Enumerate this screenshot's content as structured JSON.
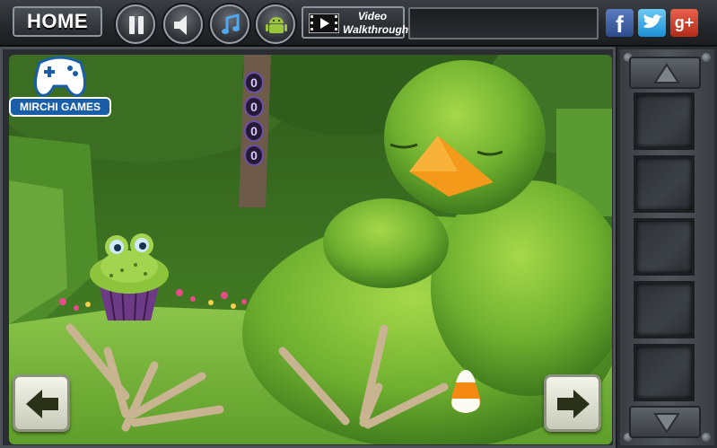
{
  "toolbar": {
    "home_label": "HOME",
    "video_line1": "Video",
    "video_line2": "Walkthrough",
    "pause_icon": "pause-icon",
    "sound_icon": "speaker-icon",
    "music_icon": "music-note-icon",
    "android_icon": "android-icon"
  },
  "social": {
    "facebook": "f",
    "twitter": "twitter-bird-icon",
    "googleplus": "g+"
  },
  "logo": {
    "text": "MIRCHI GAMES"
  },
  "scene": {
    "code_digits": [
      "0",
      "0",
      "0",
      "0"
    ],
    "items_on_ground": [
      "candy-corn"
    ],
    "character": "frog-cupcake"
  },
  "navigation": {
    "left": "arrow-left-icon",
    "right": "arrow-right-icon"
  },
  "inventory": {
    "slots": 5
  },
  "colors": {
    "toolbar_bg": "#24272b",
    "grass": "#6fb53a",
    "bush": "#7bc13f",
    "beak": "#f29a1c",
    "code_border": "#6c4fa8",
    "arrow_button": "#e9ebdf",
    "facebook": "#3b5998",
    "twitter": "#1da1f2",
    "googleplus": "#dd4b39"
  }
}
